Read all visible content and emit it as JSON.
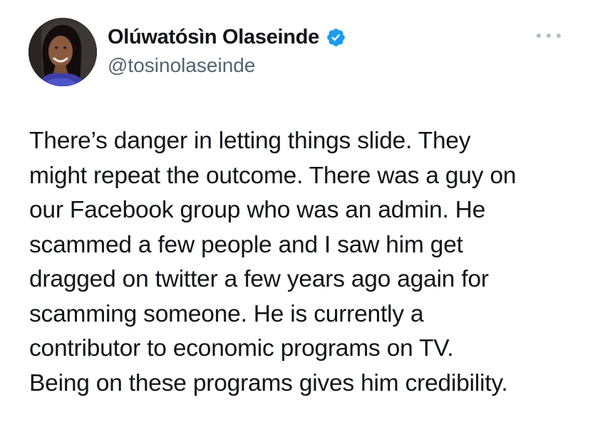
{
  "tweet": {
    "author": {
      "display_name": "Olúwatósìn Olaseinde",
      "handle": "@tosinolaseinde",
      "verified": true,
      "verified_icon": "verified-badge-icon",
      "avatar_icon": "profile-photo"
    },
    "more_icon": "more-options-icon",
    "body_lines": [
      "There’s danger in letting things slide. They",
      "might repeat the outcome. There was a guy on",
      "our Facebook group who was an admin. He",
      "scammed a few people and I saw him get",
      "dragged on twitter a few years ago again for",
      "scamming someone. He is currently a",
      "contributor to economic programs on TV.",
      "Being on these programs gives him credibility."
    ]
  },
  "colors": {
    "text_primary": "#0f1419",
    "text_secondary": "#536471",
    "verified_blue": "#1d9bf0",
    "more_dots": "#b4bcc4",
    "background": "#ffffff"
  }
}
